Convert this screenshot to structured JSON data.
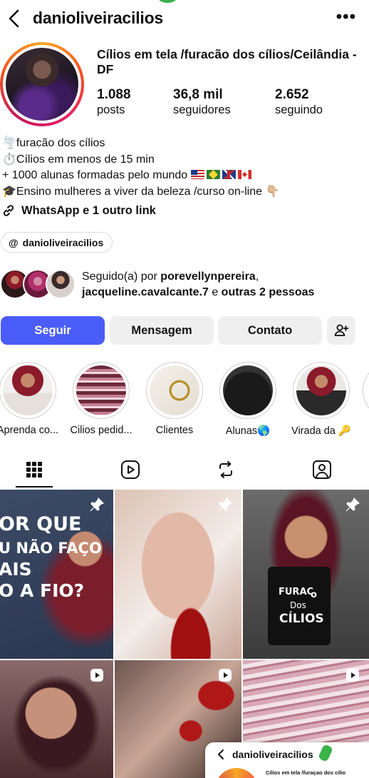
{
  "header": {
    "username": "danioliveiracilios",
    "more_icon": "more-horizontal-icon",
    "back_icon": "chevron-left-icon"
  },
  "profile": {
    "name": "Cílios em tela /furacão dos cílios/Ceilândia - DF",
    "stats": [
      {
        "value": "1.088",
        "label": "posts"
      },
      {
        "value": "36,8 mil",
        "label": "seguidores"
      },
      {
        "value": "2.652",
        "label": "seguindo"
      }
    ]
  },
  "bio": {
    "line1_emoji": "🌪️",
    "line1": "furacão dos cílios",
    "line2_emoji": "⏱️",
    "line2": "Cílios em menos de 15 min",
    "line3": "+ 1000 alunas formadas pelo mundo",
    "line4_emoji": "🎓",
    "line4": "Ensino mulheres a viver da beleza /curso on-line",
    "line4_tail": "👇🏼"
  },
  "link": {
    "text": "WhatsApp e 1 outro link"
  },
  "threads": {
    "handle": "danioliveiracilios"
  },
  "followed_by": {
    "prefix": "Seguido(a) por ",
    "user1": "porevellynpereira",
    "sep1": ",",
    "user2": "jacqueline.cavalcante.7",
    "middle": " e ",
    "others": "outras 2 pessoas"
  },
  "buttons": {
    "follow": "Seguir",
    "message": "Mensagem",
    "contact": "Contato"
  },
  "highlights": [
    {
      "label": "Aprenda co..."
    },
    {
      "label": "Cilios pedid..."
    },
    {
      "label": "Clientes"
    },
    {
      "label": "Alunas🌎"
    },
    {
      "label": "Virada da 🔑"
    }
  ],
  "tabs": [
    "grid-icon",
    "reels-icon",
    "reposts-icon",
    "tagged-icon"
  ],
  "posts": {
    "post1_text": [
      "OR QUE",
      "U NÃO FAÇO",
      "AIS",
      "O A FIO?"
    ],
    "post3_text": [
      "FURAC",
      "o",
      "Dos",
      "CÍLIOS"
    ]
  },
  "overlay": {
    "username": "danioliveiracilios",
    "name": "Cílios em tela /furaçao dos cílio"
  },
  "colors": {
    "follow_button": "#4a5df9",
    "button_bg": "#efefef",
    "story_ring": "#e91e63"
  }
}
